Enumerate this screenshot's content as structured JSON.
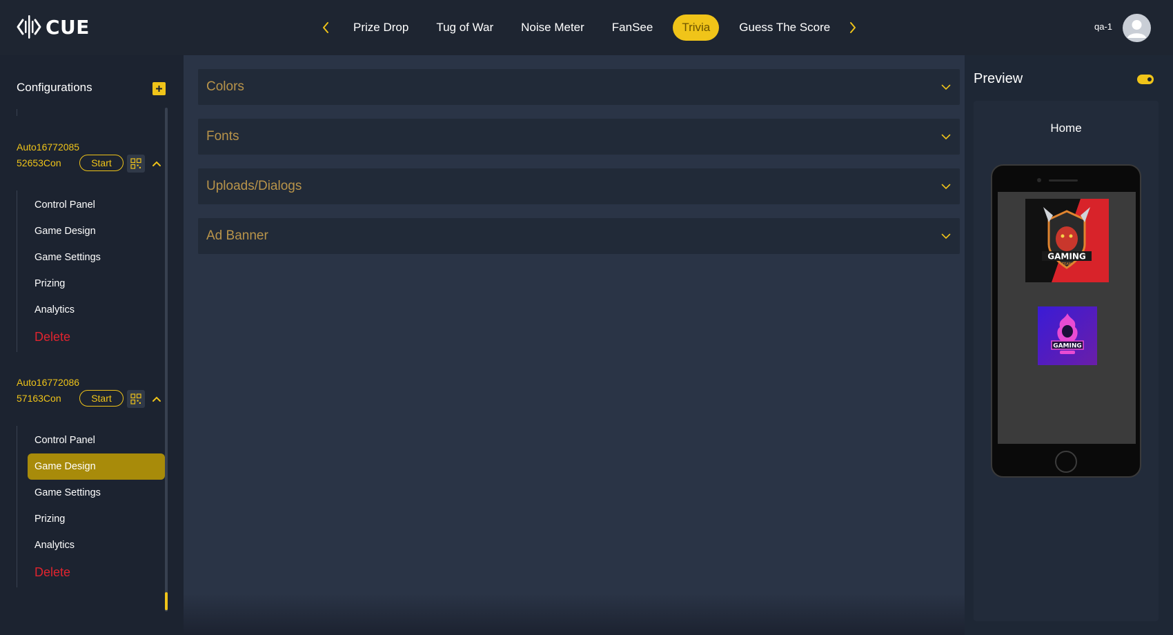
{
  "brand": {
    "name": "CUE"
  },
  "nav": {
    "tabs": [
      {
        "label": "Prize Drop",
        "active": false
      },
      {
        "label": "Tug of War",
        "active": false
      },
      {
        "label": "Noise Meter",
        "active": false
      },
      {
        "label": "FanSee",
        "active": false
      },
      {
        "label": "Trivia",
        "active": true
      },
      {
        "label": "Guess The Score",
        "active": false
      }
    ]
  },
  "user": {
    "name": "qa-1"
  },
  "sidebar": {
    "title": "Configurations",
    "configs": [
      {
        "name": "Auto1677208552653Con",
        "start_label": "Start",
        "items": [
          "Control Panel",
          "Game Design",
          "Game Settings",
          "Prizing",
          "Analytics"
        ],
        "delete_label": "Delete",
        "active_item": null
      },
      {
        "name": "Auto1677208657163Con",
        "start_label": "Start",
        "items": [
          "Control Panel",
          "Game Design",
          "Game Settings",
          "Prizing",
          "Analytics"
        ],
        "delete_label": "Delete",
        "active_item": "Game Design"
      }
    ]
  },
  "main": {
    "sections": [
      "Colors",
      "Fonts",
      "Uploads/Dialogs",
      "Ad Banner"
    ]
  },
  "preview": {
    "title": "Preview",
    "toggle_on": true,
    "screen_title": "Home",
    "logo1_text": "GAMING",
    "logo1_sub": "TEAM",
    "logo2_text": "GAMING"
  },
  "colors": {
    "accent": "#f0c419",
    "delete": "#e0242f",
    "section_label": "#b9944a",
    "active_item_bg": "#a88b0a"
  }
}
